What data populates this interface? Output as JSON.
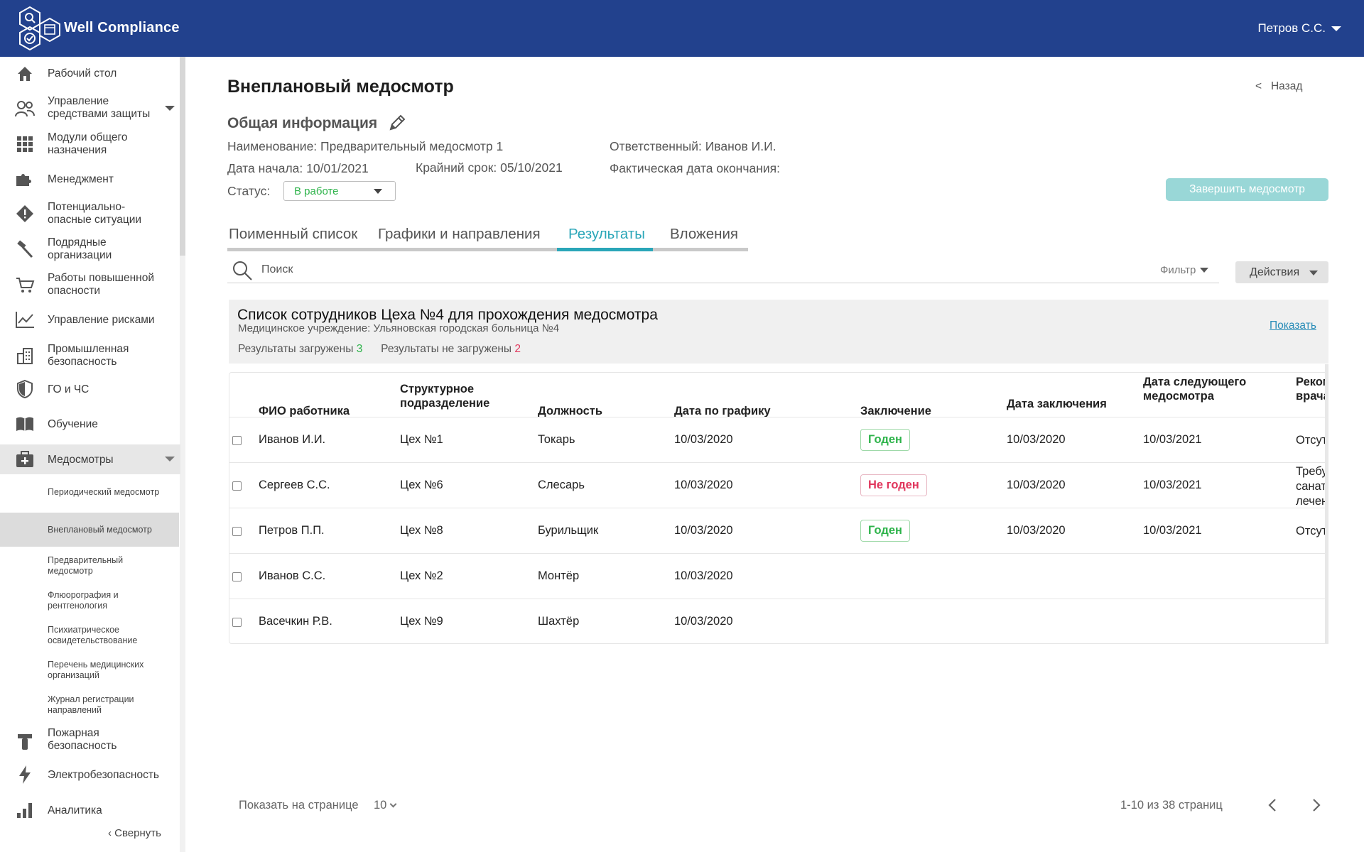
{
  "header": {
    "brand": "Well Compliance",
    "user": "Петров С.С."
  },
  "sidebar": {
    "items": [
      {
        "label": "Рабочий стол",
        "icon": "home-icon"
      },
      {
        "label": "Управление средствами защиты",
        "icon": "people-icon"
      },
      {
        "label": "Модули общего назначения",
        "icon": "grid-icon"
      },
      {
        "label": "Менеджмент",
        "icon": "puzzle-icon"
      },
      {
        "label": "Потенциально-опасные ситуации",
        "icon": "warning-icon"
      },
      {
        "label": "Подрядные организации",
        "icon": "hammer-icon"
      },
      {
        "label": "Работы повышенной опасности",
        "icon": "cart-icon"
      },
      {
        "label": "Управление рисками",
        "icon": "line-chart-icon"
      },
      {
        "label": "Промышленная безопасность",
        "icon": "building-icon"
      },
      {
        "label": "ГО и ЧС",
        "icon": "shield-icon"
      },
      {
        "label": "Обучение",
        "icon": "book-icon"
      },
      {
        "label": "Медосмотры",
        "icon": "medkit-icon"
      },
      {
        "label": "Пожарная безопасность",
        "icon": "extinguisher-icon"
      },
      {
        "label": "Электробезопасность",
        "icon": "lightning-icon"
      },
      {
        "label": "Аналитика",
        "icon": "bar-chart-icon"
      }
    ],
    "subitems": [
      {
        "label": "Периодический медосмотр"
      },
      {
        "label": "Внеплановый медосмотр"
      },
      {
        "label": "Предварительный медосмотр"
      },
      {
        "label": "Флюорография и рентгенология"
      },
      {
        "label": "Психиатрическое освидетельствование"
      },
      {
        "label": "Перечень медицинских организаций"
      },
      {
        "label": "Журнал регистрации направлений"
      }
    ],
    "collapse": "Свернуть"
  },
  "main": {
    "title": "Внеплановый медосмотр",
    "back": "Назад",
    "section_title": "Общая информация",
    "name_line": "Наименование: Предварительный медосмотр 1",
    "start_line": "Дата начала: 10/01/2021",
    "deadline_line": "Крайний срок: 05/10/2021",
    "responsible_line": "Ответственный: Иванов И.И.",
    "actual_end_line": "Фактическая дата окончания:",
    "status_label": "Статус:",
    "status_value": "В работе",
    "finish_button": "Завершить медосмотр",
    "tabs": [
      {
        "label": "Поименный список"
      },
      {
        "label": "Графики и направления"
      },
      {
        "label": "Результаты"
      },
      {
        "label": "Вложения"
      }
    ],
    "search_placeholder": "Поиск",
    "filter": "Фильтр",
    "actions": "Действия"
  },
  "panel": {
    "title": "Список сотрудников Цеха №4 для прохождения медосмотра",
    "subtitle": "Медицинское учреждение: Ульяновская городская больница №4",
    "loaded_label": "Результаты загружены",
    "loaded_count": "3",
    "not_loaded_label": "Результаты не загружены",
    "not_loaded_count": "2",
    "show_link": "Показать"
  },
  "table": {
    "headers": {
      "name": "ФИО работника",
      "unit": "Структурное подразделение",
      "position": "Должность",
      "schedule": "Дата по графику",
      "conclusion": "Заключение",
      "conclusion_date": "Дата заключения",
      "next_date": "Дата следующего медосмотра",
      "recommendation": "Рекомендации врача"
    },
    "rows": [
      {
        "name": "Иванов И.И.",
        "unit": "Цех №1",
        "position": "Токарь",
        "schedule": "10/03/2020",
        "conclusion": "Годен",
        "conclusion_status": "ok",
        "conclusion_date": "10/03/2020",
        "next_date": "10/03/2021",
        "recommendation": "Отсутствуют"
      },
      {
        "name": "Сергеев С.С.",
        "unit": "Цех №6",
        "position": "Слесарь",
        "schedule": "10/03/2020",
        "conclusion": "Не годен",
        "conclusion_status": "bad",
        "conclusion_date": "10/03/2020",
        "next_date": "10/03/2021",
        "recommendation": "Требуется санаторное лечение"
      },
      {
        "name": "Петров П.П.",
        "unit": "Цех №8",
        "position": "Бурильщик",
        "schedule": "10/03/2020",
        "conclusion": "Годен",
        "conclusion_status": "ok",
        "conclusion_date": "10/03/2020",
        "next_date": "10/03/2021",
        "recommendation": "Отсутствуют"
      },
      {
        "name": "Иванов С.С.",
        "unit": "Цех №2",
        "position": "Монтёр",
        "schedule": "10/03/2020",
        "conclusion": "",
        "conclusion_status": "",
        "conclusion_date": "",
        "next_date": "",
        "recommendation": ""
      },
      {
        "name": "Васечкин Р.В.",
        "unit": "Цех №9",
        "position": "Шахтёр",
        "schedule": "10/03/2020",
        "conclusion": "",
        "conclusion_status": "",
        "conclusion_date": "",
        "next_date": "",
        "recommendation": ""
      }
    ]
  },
  "pager": {
    "per_page_label": "Показать на странице",
    "per_page_value": "10",
    "info": "1-10 из 38 страниц"
  },
  "colors": {
    "header_bg": "#22418d",
    "accent": "#2aa6b8",
    "ok": "#2db34a",
    "bad": "#e0365c",
    "finish_button": "#99d7d7"
  }
}
